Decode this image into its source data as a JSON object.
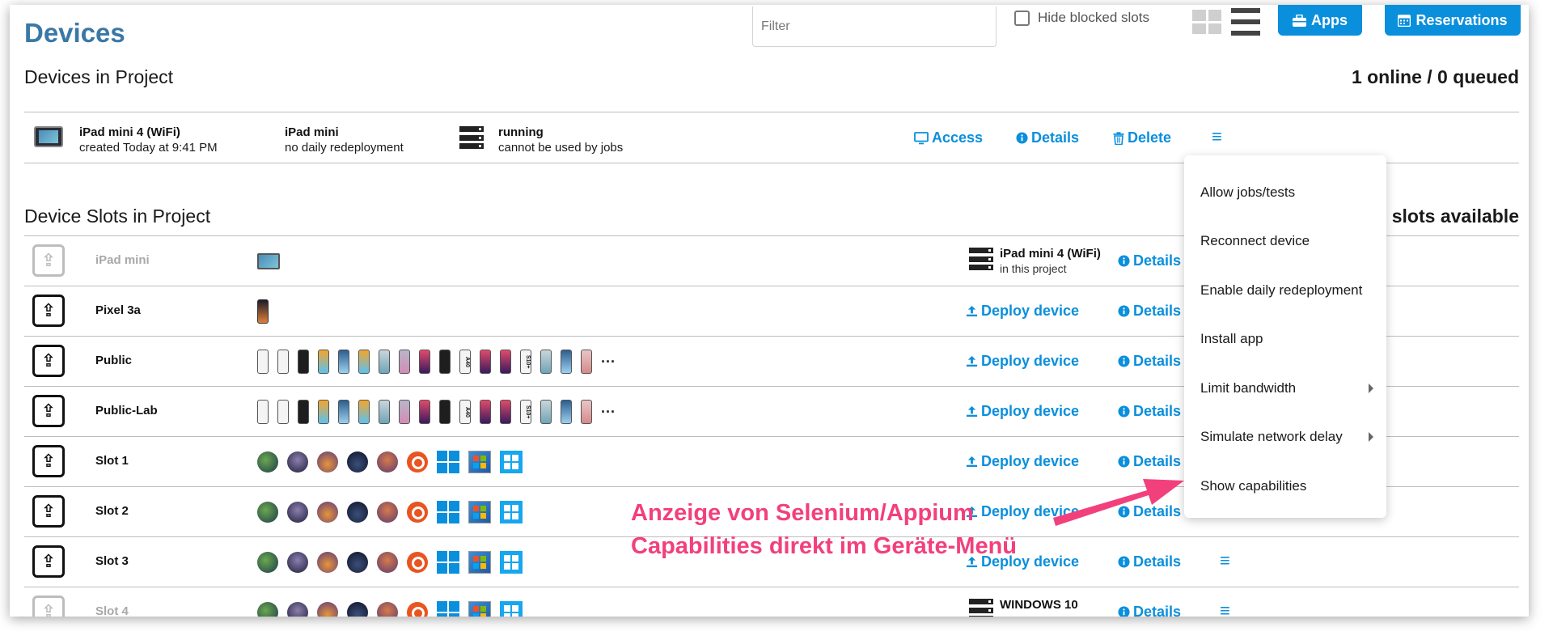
{
  "header": {
    "title": "Devices",
    "filter_placeholder": "Filter",
    "hide_blocked_label": "Hide blocked slots",
    "apps_label": "Apps",
    "reservations_label": "Reservations"
  },
  "devices_section": {
    "title": "Devices in Project",
    "status": "1 online / 0 queued",
    "device": {
      "name": "iPad mini 4 (WiFi)",
      "created": "created Today at 9:41 PM",
      "model": "iPad mini",
      "redeploy": "no daily redeployment",
      "state": "running",
      "state_note": "cannot be used by jobs",
      "access_label": "Access",
      "details_label": "Details",
      "delete_label": "Delete"
    }
  },
  "slots_section": {
    "title": "Device Slots in Project",
    "availability": "0 slots available",
    "deploy_label": "Deploy device",
    "details_label": "Details",
    "more_glyph": "···",
    "slots": [
      {
        "name": "iPad mini",
        "assigned_device": "iPad mini 4 (WiFi)",
        "assigned_note": "in this project"
      },
      {
        "name": "Pixel 3a"
      },
      {
        "name": "Public"
      },
      {
        "name": "Public-Lab"
      },
      {
        "name": "Slot 1"
      },
      {
        "name": "Slot 2"
      },
      {
        "name": "Slot 3"
      },
      {
        "name": "Slot 4",
        "assigned_device": "WINDOWS 10"
      }
    ],
    "phone_labels": {
      "a40": "A40",
      "s10": "S10+"
    }
  },
  "context_menu": {
    "items": [
      {
        "label": "Allow jobs/tests"
      },
      {
        "label": "Reconnect device"
      },
      {
        "label": "Enable daily redeployment"
      },
      {
        "label": "Install app"
      },
      {
        "label": "Limit bandwidth"
      },
      {
        "label": "Simulate network delay"
      },
      {
        "label": "Show capabilities"
      }
    ]
  },
  "annotation": {
    "line1": "Anzeige von Selenium/Appium",
    "line2": "Capabilities direkt im Geräte-Menü",
    "color": "#f2407c"
  },
  "colors": {
    "accent": "#0a8fdc",
    "title": "#3a78a6"
  },
  "icons": {
    "upload": "upload-icon",
    "server": "server-icon",
    "monitor": "monitor-icon",
    "info": "info-icon",
    "trash": "trash-icon",
    "menu": "hamburger-icon"
  }
}
